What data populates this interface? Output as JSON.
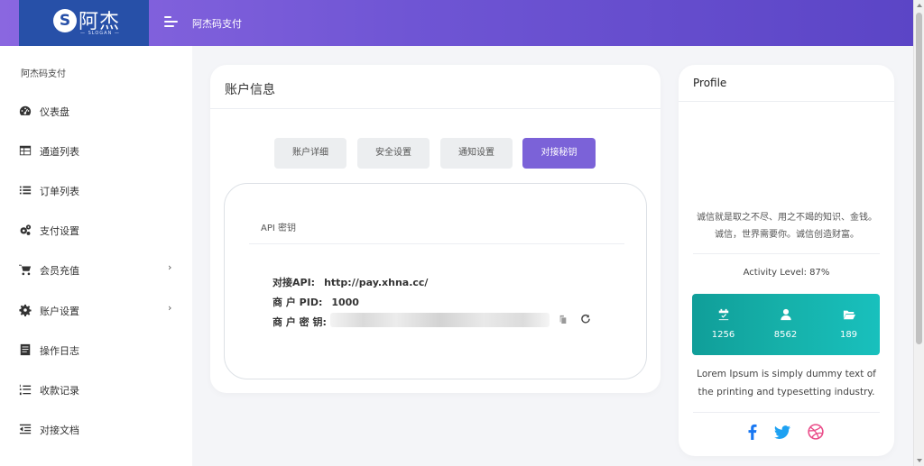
{
  "header": {
    "logo_mark": "S",
    "logo_text": "阿杰",
    "logo_slogan": "— SLOGAN —",
    "title": "阿杰码支付"
  },
  "sidebar": {
    "title": "阿杰码支付",
    "items": [
      {
        "label": "仪表盘",
        "icon": "dashboard-icon"
      },
      {
        "label": "通道列表",
        "icon": "table-icon"
      },
      {
        "label": "订单列表",
        "icon": "list-icon"
      },
      {
        "label": "支付设置",
        "icon": "cogs-icon"
      },
      {
        "label": "会员充值",
        "icon": "cart-icon",
        "chevron": "›"
      },
      {
        "label": "账户设置",
        "icon": "gear-icon",
        "chevron": "›"
      },
      {
        "label": "操作日志",
        "icon": "book-icon"
      },
      {
        "label": "收款记录",
        "icon": "numbered-list-icon"
      },
      {
        "label": "对接文档",
        "icon": "outdent-icon"
      }
    ]
  },
  "main": {
    "title": "账户信息",
    "tabs": [
      {
        "label": "账户详细",
        "active": false
      },
      {
        "label": "安全设置",
        "active": false
      },
      {
        "label": "通知设置",
        "active": false
      },
      {
        "label": "对接秘钥",
        "active": true
      }
    ],
    "api_section": {
      "title": "API 密钥",
      "api_label": "对接API:",
      "api_value": "http://pay.xhna.cc/",
      "pid_label": "商 户 PID:",
      "pid_value": "1000",
      "key_label": "商 户 密 钥:"
    }
  },
  "profile": {
    "title": "Profile",
    "quote": "诚信就是取之不尽、用之不竭的知识、金钱。诚信，世界需要你。诚信创造财富。",
    "activity": "Activity Level: 87%",
    "activity_level_percent": 87,
    "stats": [
      {
        "icon": "calendar-check-icon",
        "value": "1256"
      },
      {
        "icon": "user-icon",
        "value": "8562"
      },
      {
        "icon": "folder-open-icon",
        "value": "189"
      }
    ],
    "description": "Lorem Ipsum is simply dummy text of the printing and typesetting industry.",
    "social": [
      {
        "icon": "facebook-icon",
        "color": "#1877f2"
      },
      {
        "icon": "twitter-icon",
        "color": "#1da1f2"
      },
      {
        "icon": "dribbble-icon",
        "color": "#ea4c89"
      }
    ]
  },
  "colors": {
    "header_gradient_start": "#8a67e0",
    "header_gradient_end": "#5b45c6",
    "logo_bg": "#2750a8",
    "active_tab": "#7b62d8",
    "stats_bg": "#16b1aa"
  }
}
